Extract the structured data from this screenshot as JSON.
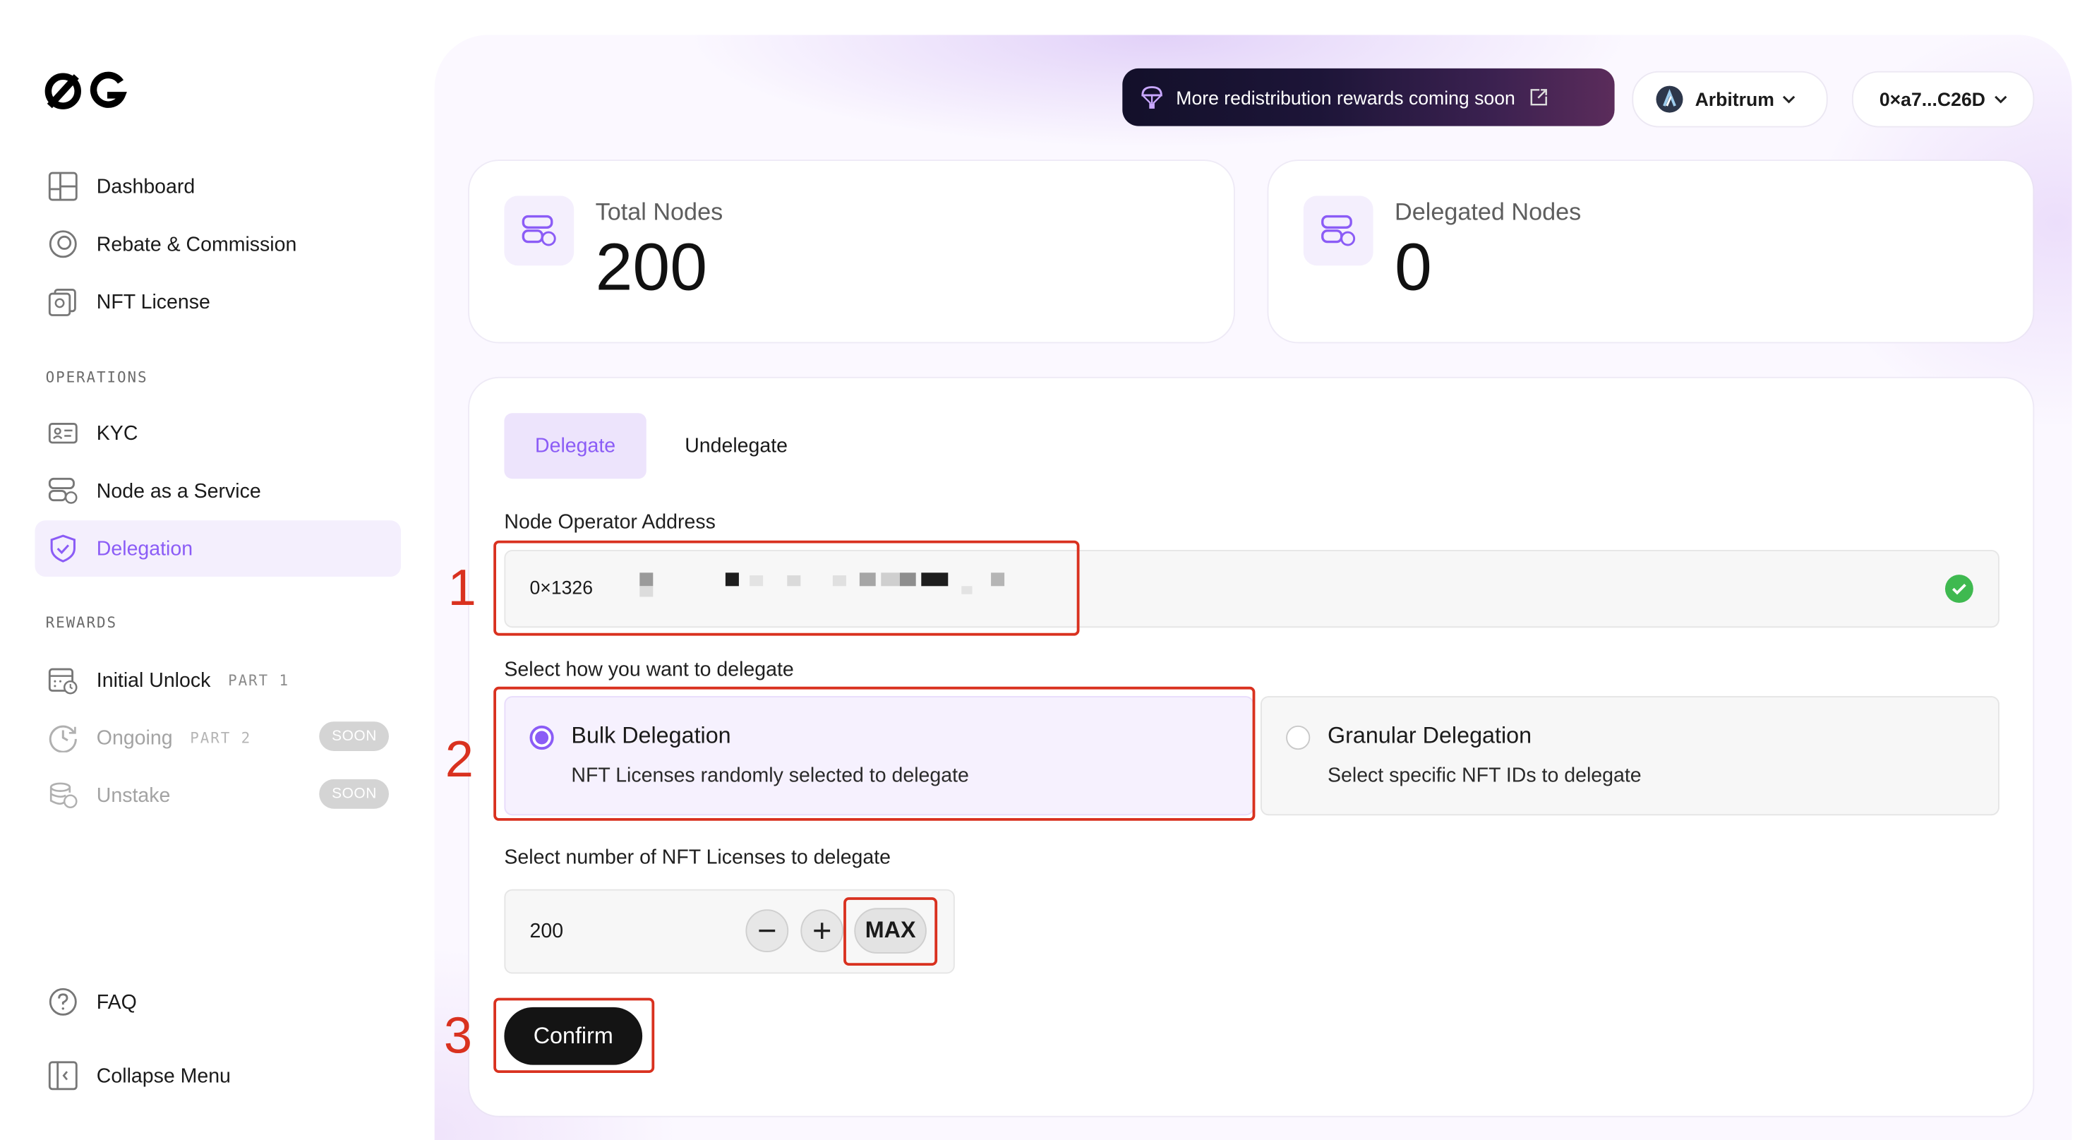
{
  "sidebar": {
    "items_top": [
      {
        "label": "Dashboard"
      },
      {
        "label": "Rebate & Commission"
      },
      {
        "label": "NFT License"
      }
    ],
    "operations_heading": "OPERATIONS",
    "operations": [
      {
        "label": "KYC"
      },
      {
        "label": "Node as a Service"
      },
      {
        "label": "Delegation",
        "active": true
      }
    ],
    "rewards_heading": "REWARDS",
    "rewards": [
      {
        "label": "Initial Unlock",
        "part": "PART 1"
      },
      {
        "label": "Ongoing",
        "part": "PART 2",
        "badge": "SOON"
      },
      {
        "label": "Unstake",
        "badge": "SOON"
      }
    ],
    "bottom": [
      {
        "label": "FAQ"
      },
      {
        "label": "Collapse Menu"
      }
    ]
  },
  "header": {
    "banner_text": "More redistribution rewards coming soon",
    "network": "Arbitrum",
    "wallet": "0×a7...C26D"
  },
  "stats": {
    "total_nodes_label": "Total Nodes",
    "total_nodes_value": "200",
    "delegated_nodes_label": "Delegated Nodes",
    "delegated_nodes_value": "0"
  },
  "form": {
    "tabs": [
      {
        "label": "Delegate",
        "active": true
      },
      {
        "label": "Undelegate"
      }
    ],
    "address_label": "Node Operator Address",
    "address_value": "0×1326",
    "delegate_how_label": "Select how you want to delegate",
    "options": [
      {
        "title": "Bulk Delegation",
        "desc": "NFT Licenses randomly selected to delegate",
        "selected": true
      },
      {
        "title": "Granular Delegation",
        "desc": "Select specific NFT IDs to delegate",
        "selected": false
      }
    ],
    "quantity_label": "Select number of NFT Licenses to delegate",
    "quantity_value": "200",
    "max_label": "MAX",
    "confirm_label": "Confirm"
  },
  "annotations": {
    "step1": "1",
    "step2": "2",
    "step3": "3"
  },
  "colors": {
    "accent": "#8b5cf6",
    "active_bg": "#f4effd",
    "highlight": "#d9311f",
    "success": "#3fb950"
  }
}
